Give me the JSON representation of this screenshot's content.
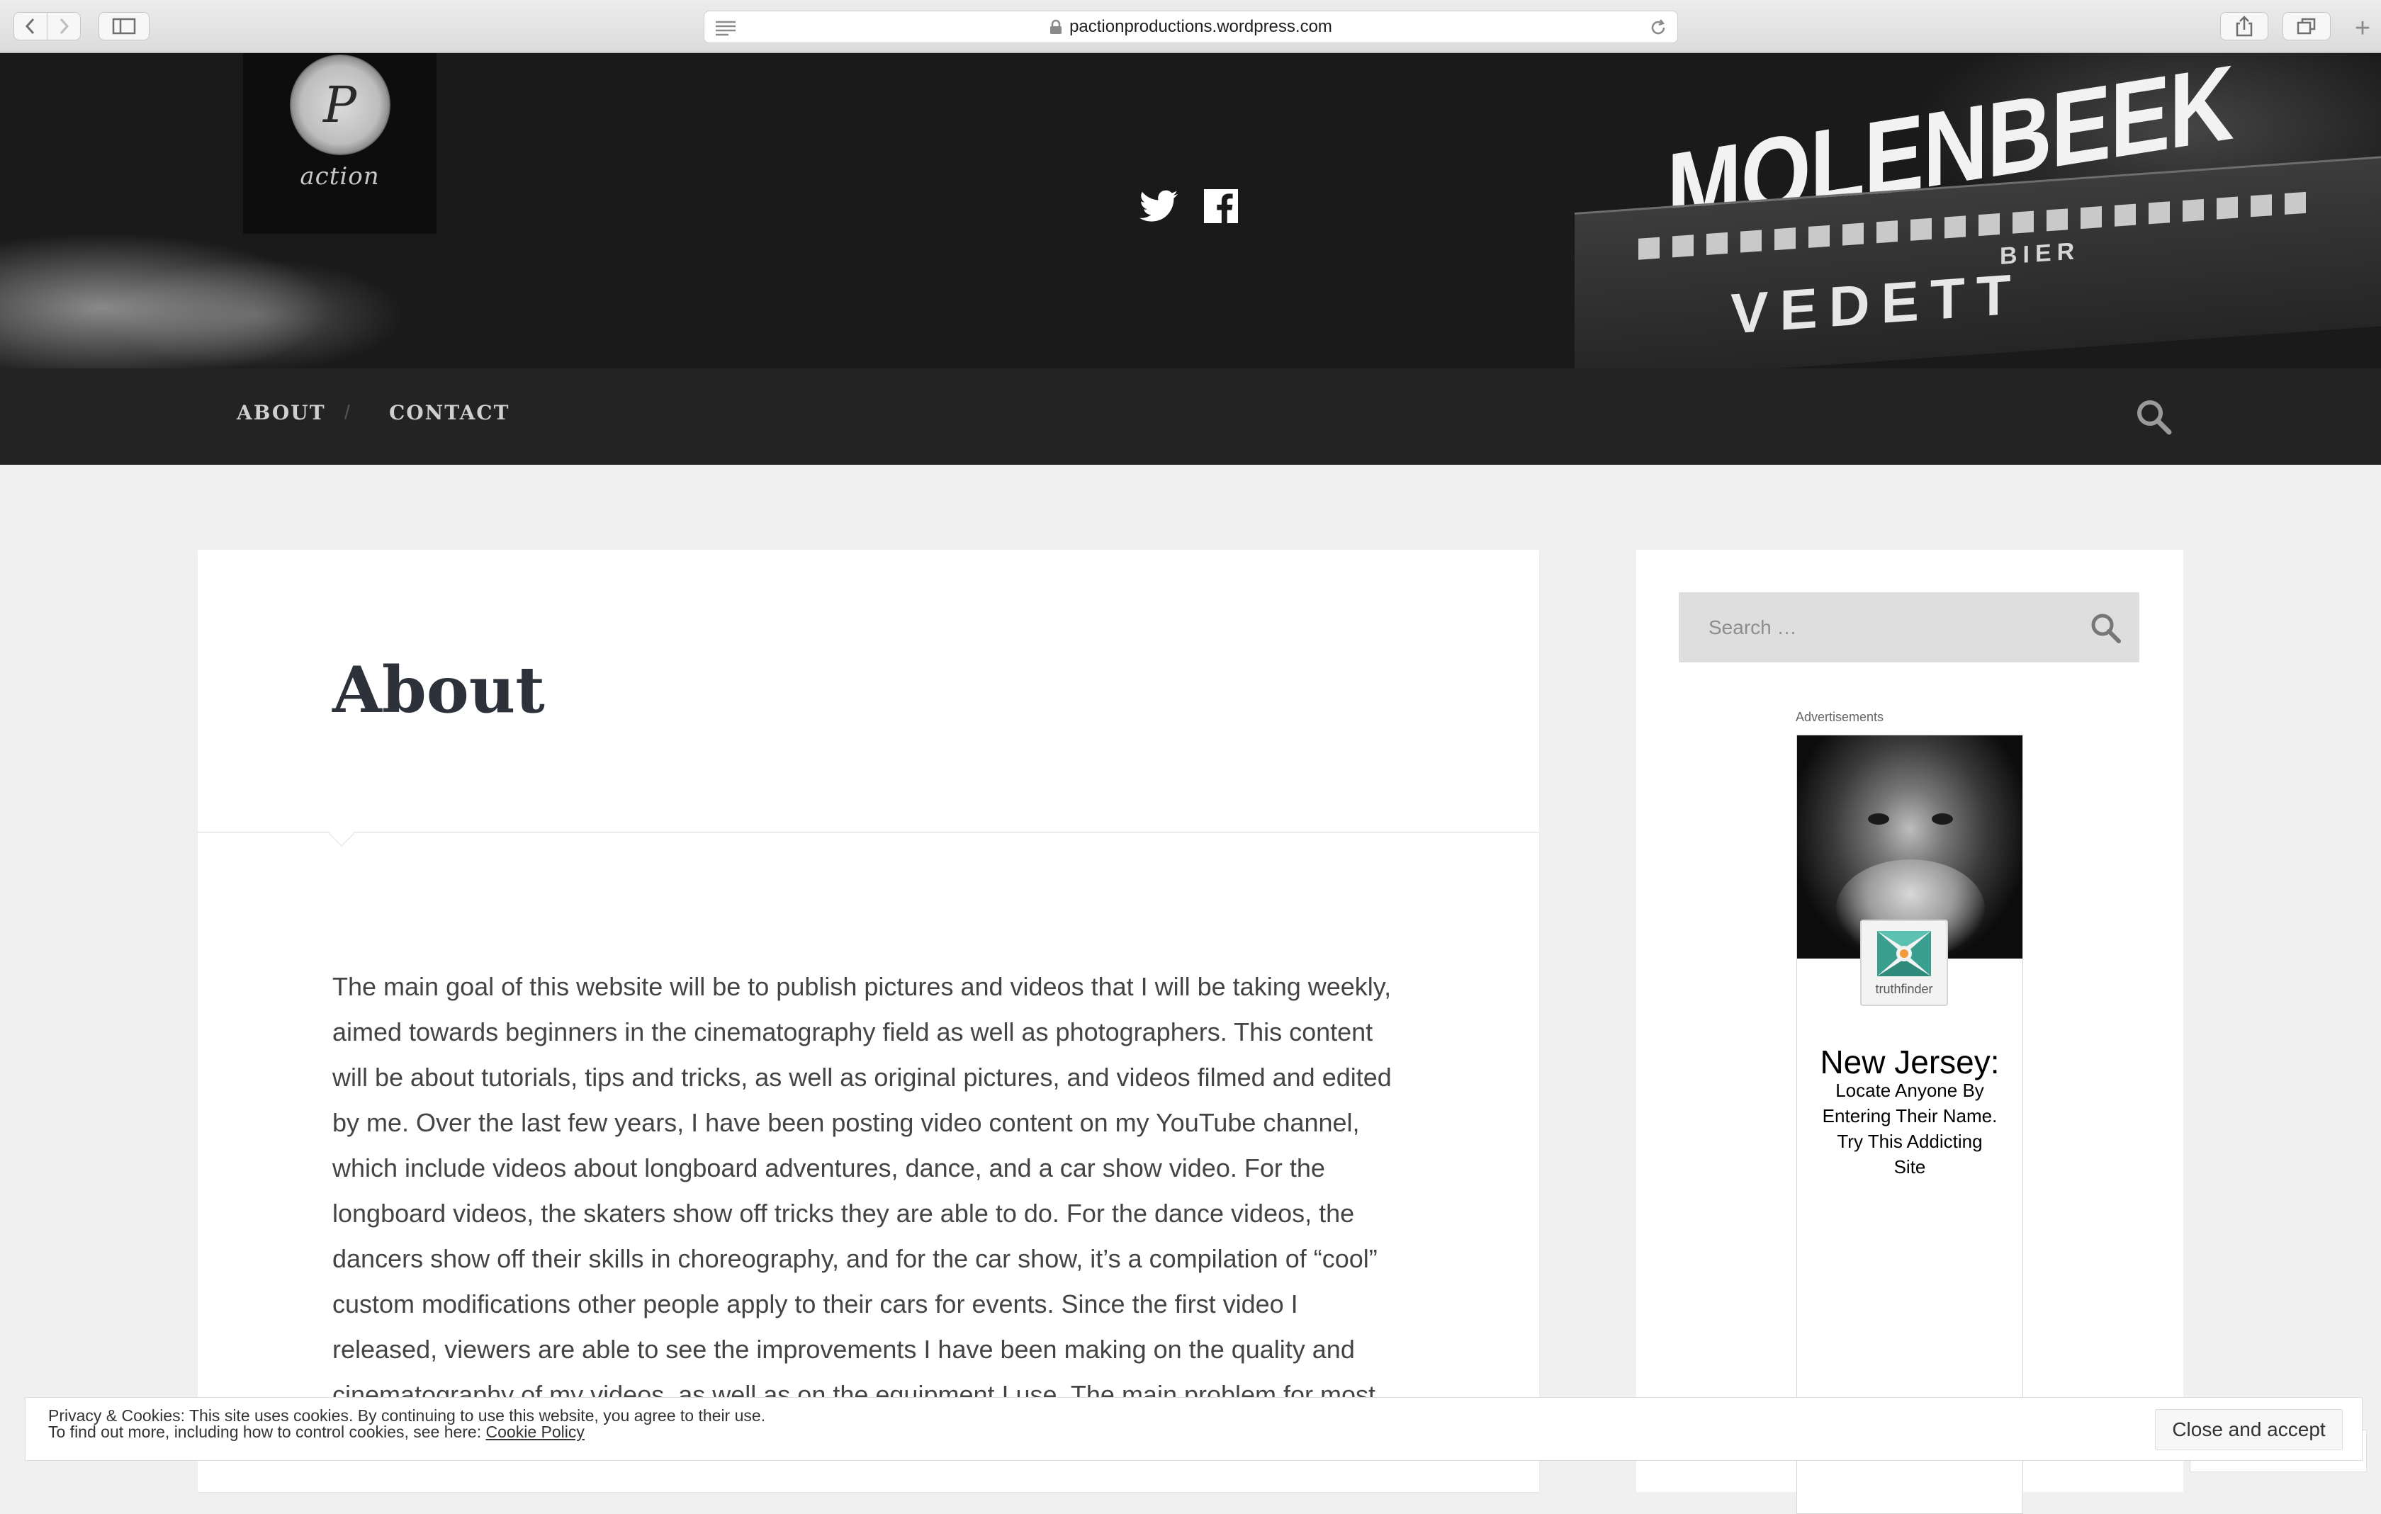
{
  "browser": {
    "url": "pactionproductions.wordpress.com",
    "new_tab_label": "+"
  },
  "header": {
    "logo_letter": "P",
    "logo_text": "action",
    "backdrop_sign": "MOLENBEEK",
    "backdrop_brand": "VEDETT",
    "backdrop_bier": "BIER",
    "social": [
      "twitter-icon",
      "facebook-icon"
    ]
  },
  "nav": {
    "items": [
      "ABOUT",
      "CONTACT"
    ],
    "separator": "/"
  },
  "article": {
    "title": "About",
    "body": "The main goal of this website will be to publish pictures and videos that I will be taking weekly, aimed towards beginners in the cinematography field as well as photographers. This content will be about tutorials, tips and tricks, as well as original pictures, and videos filmed and edited by me. Over the last few years, I have been posting video content on my YouTube channel, which include videos about longboard adventures, dance, and a car show video. For the longboard videos, the skaters show off tricks they are able to do. For the dance videos, the dancers show off their skills in choreography, and for the car show, it’s a compilation of “cool” custom modifications other people apply to their cars for events. Since the first video I released, viewers are able to see the improvements I have been making on the quality and cinematography of my videos, as well as on the equipment I use. The main problem for most the video. By using popular songs, these videos often run into copyright issues, which can"
  },
  "sidebar": {
    "search_placeholder": "Search …",
    "ads_label": "Advertisements",
    "ad": {
      "badge": "truthfinder",
      "heading": "New Jersey:",
      "body_lines": [
        "Locate Anyone By",
        "Entering Their Name.",
        "Try This Addicting",
        "Site"
      ]
    }
  },
  "cookie": {
    "line1": "Privacy & Cookies: This site uses cookies. By continuing to use this website, you agree to their use.",
    "line2": "To find out more, including how to control cookies, see here:",
    "link": "Cookie Policy",
    "accept": "Close and accept"
  },
  "colors": {
    "header_bg": "#1a1a1a",
    "nav_bg": "#232323",
    "page_bg": "#f0f0f0",
    "title": "#2d3139",
    "body": "#444444"
  }
}
